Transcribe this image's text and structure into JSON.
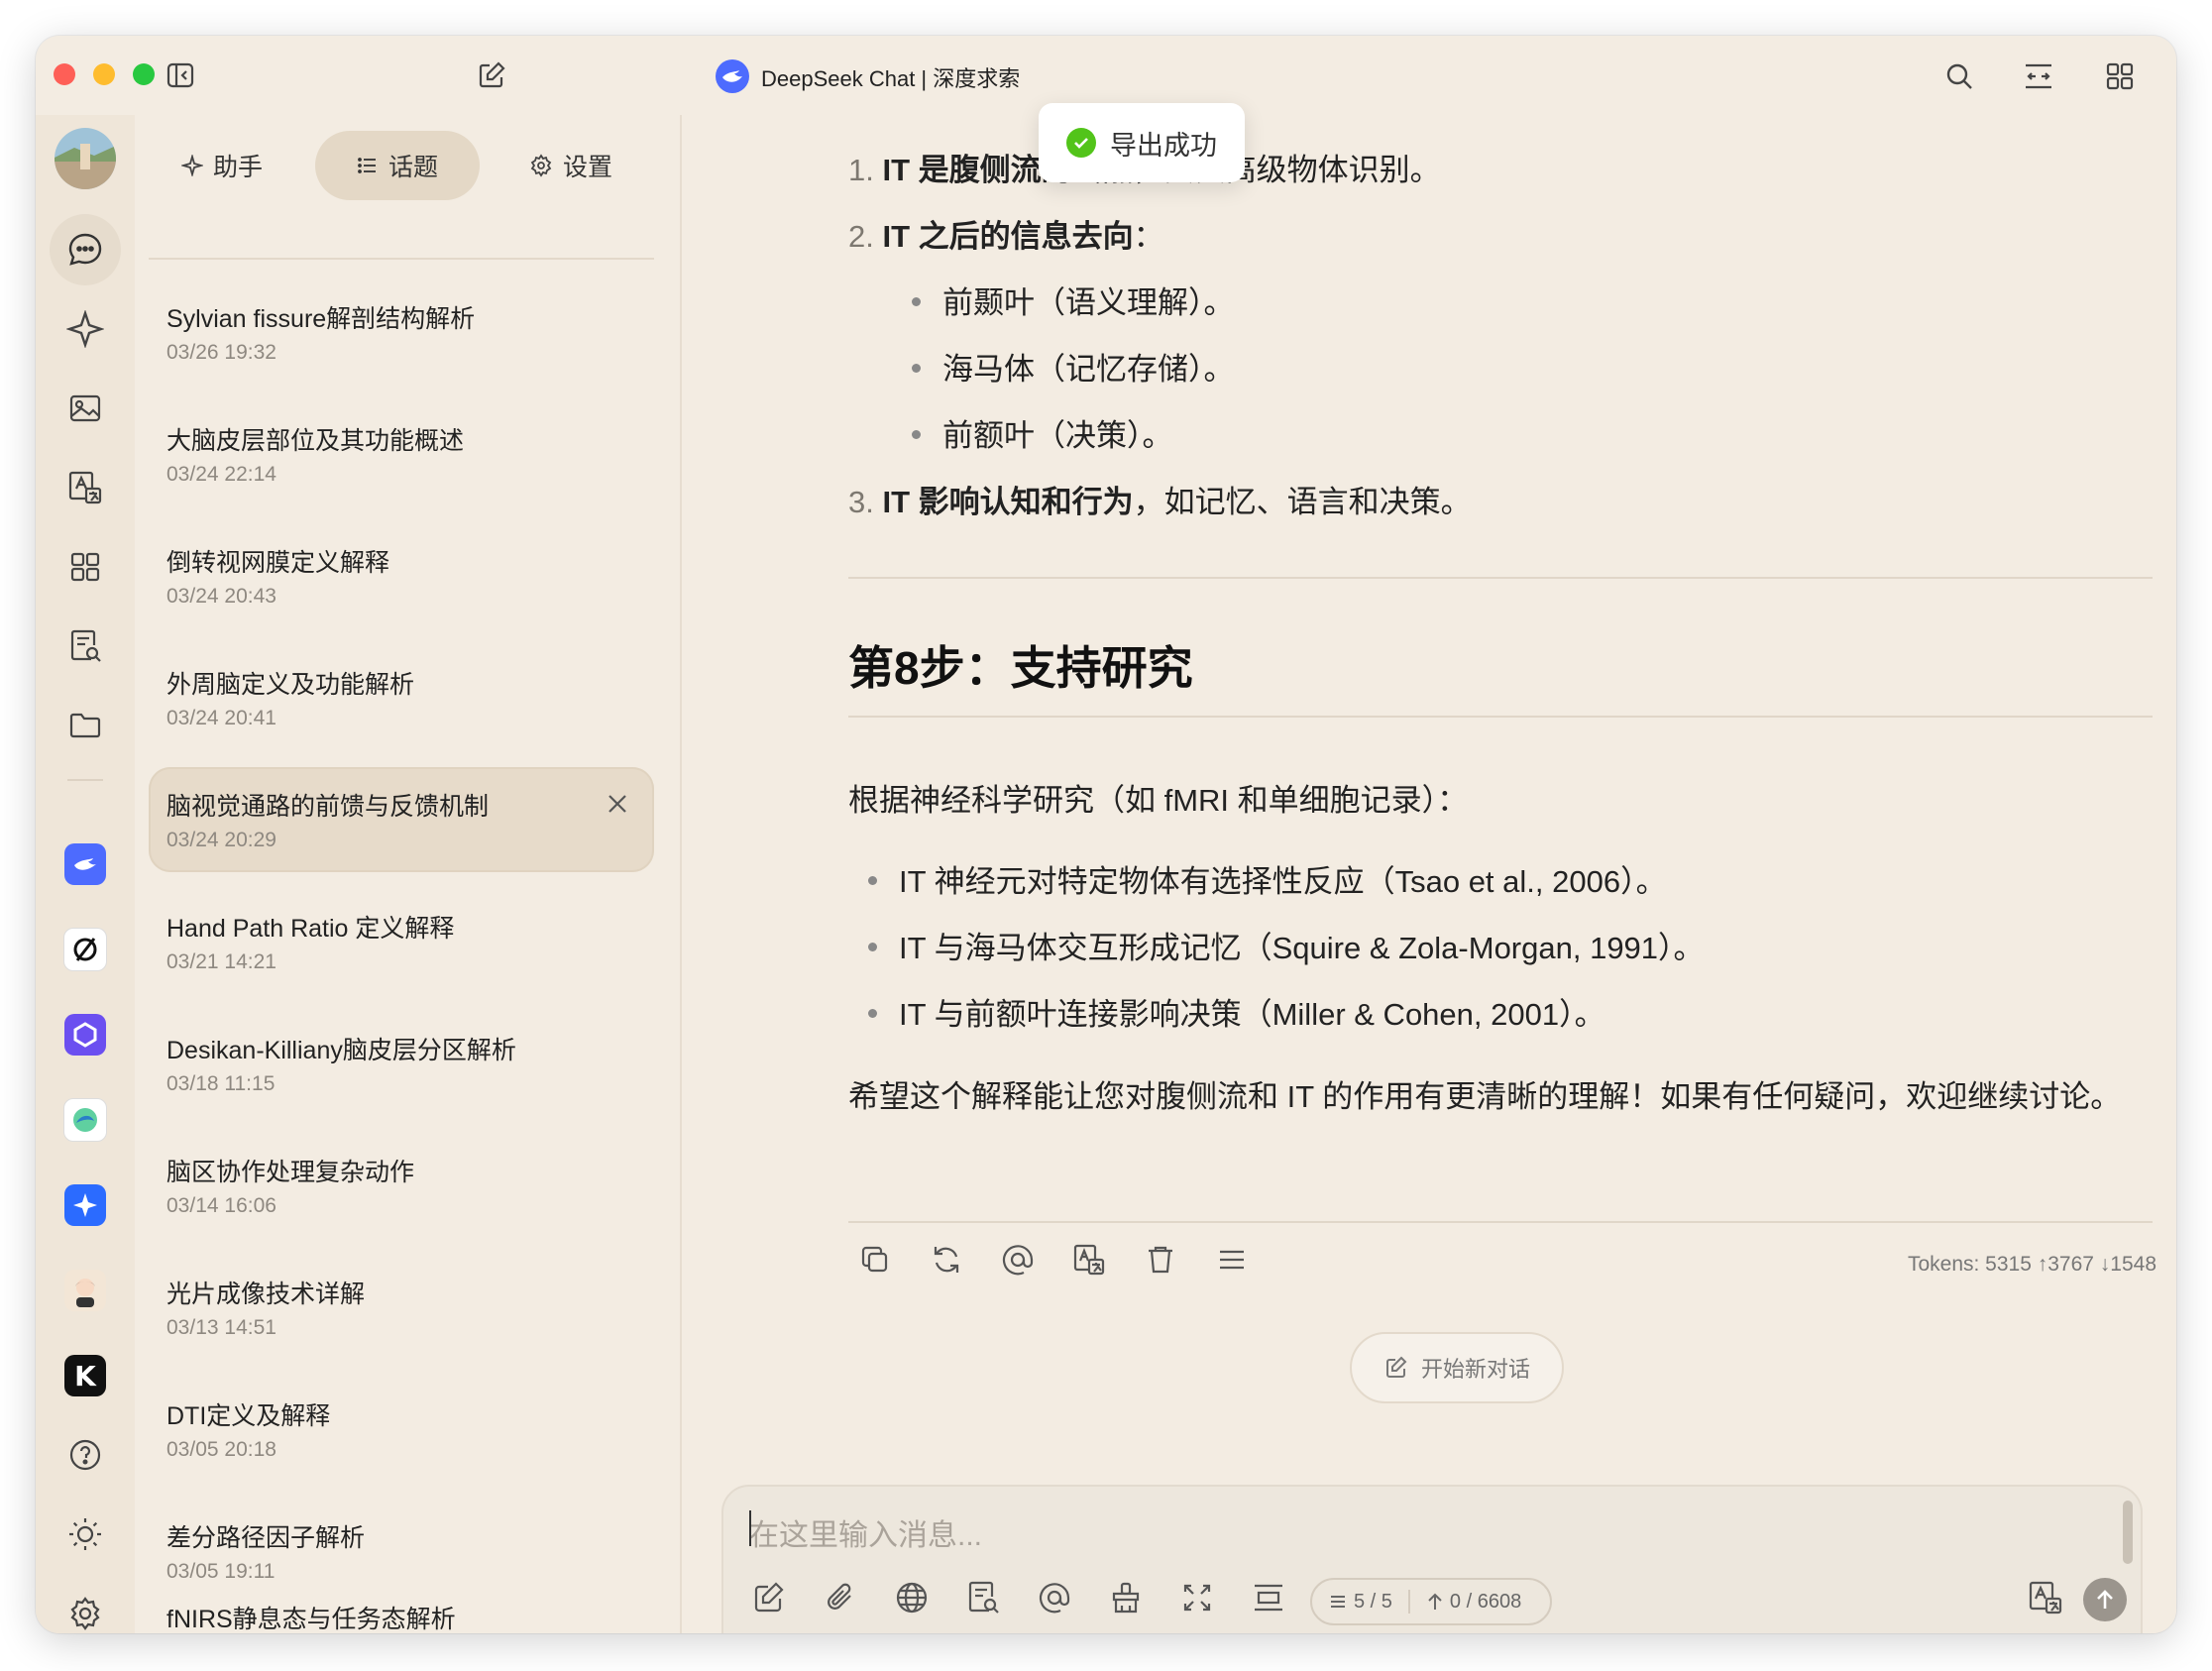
{
  "window": {
    "title": "DeepSeek Chat | 深度求索"
  },
  "toast": {
    "text": "导出成功"
  },
  "sidebar": {
    "tabs": [
      {
        "label": "助手",
        "icon": "sparkle-icon"
      },
      {
        "label": "话题",
        "icon": "list-icon"
      },
      {
        "label": "设置",
        "icon": "gear-icon"
      }
    ],
    "topics": [
      {
        "title": "Sylvian fissure解剖结构解析",
        "date": "03/26 19:32"
      },
      {
        "title": "大脑皮层部位及其功能概述",
        "date": "03/24 22:14"
      },
      {
        "title": "倒转视网膜定义解释",
        "date": "03/24 20:43"
      },
      {
        "title": "外周脑定义及功能解析",
        "date": "03/24 20:41"
      },
      {
        "title": "脑视觉通路的前馈与反馈机制",
        "date": "03/24 20:29"
      },
      {
        "title": "Hand Path Ratio 定义解释",
        "date": "03/21 14:21"
      },
      {
        "title": "Desikan-Killiany脑皮层分区解析",
        "date": "03/18 11:15"
      },
      {
        "title": "脑区协作处理复杂动作",
        "date": "03/14 16:06"
      },
      {
        "title": "光片成像技术详解",
        "date": "03/13 14:51"
      },
      {
        "title": "DTI定义及解释",
        "date": "03/05 20:18"
      },
      {
        "title": "差分路径因子解析",
        "date": "03/05 19:11"
      },
      {
        "title": "fNIRS静息态与任务态解析",
        "date": ""
      }
    ]
  },
  "message": {
    "ol": [
      {
        "num": "1.",
        "bold": "IT 是腹侧流的终点",
        "rest": "，负责高级物体识别。"
      },
      {
        "num": "2.",
        "bold": "IT 之后的信息去向",
        "rest": "："
      },
      {
        "num": "3.",
        "bold": "IT 影响认知和行为",
        "rest": "，如记忆、语言和决策。"
      }
    ],
    "sub_bullets": [
      "前颞叶（语义理解）。",
      "海马体（记忆存储）。",
      "前额叶（决策）。"
    ],
    "heading": "第8步：支持研究",
    "intro": "根据神经科学研究（如 fMRI 和单细胞记录）：",
    "bullets": [
      "IT 神经元对特定物体有选择性反应（Tsao et al., 2006）。",
      "IT 与海马体交互形成记忆（Squire & Zola-Morgan, 1991）。",
      "IT 与前额叶连接影响决策（Miller & Cohen, 2001）。"
    ],
    "closing": "希望这个解释能让您对腹侧流和 IT 的作用有更清晰的理解！如果有任何疑问，欢迎继续讨论。",
    "tokens": "Tokens: 5315 ↑3767 ↓1548"
  },
  "new_chat_label": "开始新对话",
  "input": {
    "placeholder": "在这里输入消息...",
    "context_count": "5 / 5",
    "token_count": "0 / 6608"
  }
}
